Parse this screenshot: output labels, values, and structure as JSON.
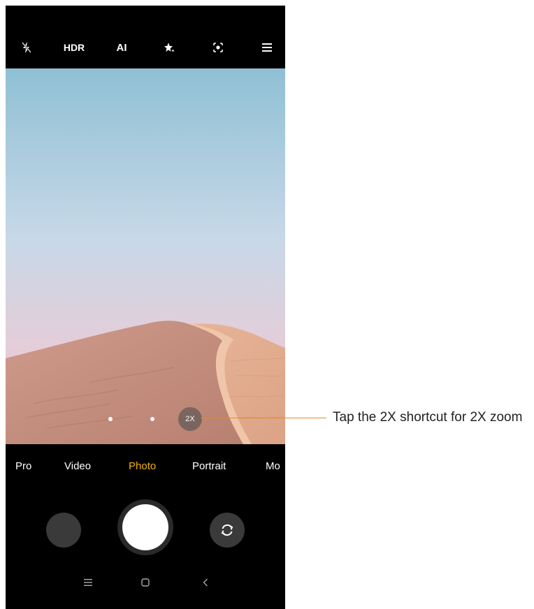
{
  "topbar": {
    "flash_icon": "flash-off-icon",
    "hdr_label": "HDR",
    "ai_label": "AI",
    "beauty_icon": "sparkle-icon",
    "lens_icon": "google-lens-icon",
    "menu_icon": "hamburger-menu-icon"
  },
  "viewfinder": {
    "zoom_shortcut_label": "2X"
  },
  "modes": [
    {
      "label": "Pro"
    },
    {
      "label": "Video"
    },
    {
      "label": "Photo",
      "active": true
    },
    {
      "label": "Portrait"
    },
    {
      "label": "Mo"
    }
  ],
  "controls": {
    "gallery_icon": "gallery-thumbnail",
    "shutter_icon": "shutter-button",
    "switch_icon": "switch-camera-icon"
  },
  "navbar": {
    "recents_icon": "recents-icon",
    "home_icon": "home-icon",
    "back_icon": "back-icon"
  },
  "callout": {
    "text": "Tap the 2X shortcut for 2X zoom"
  },
  "colors": {
    "accent": "#f3b300",
    "callout_line": "#e58a2a"
  }
}
